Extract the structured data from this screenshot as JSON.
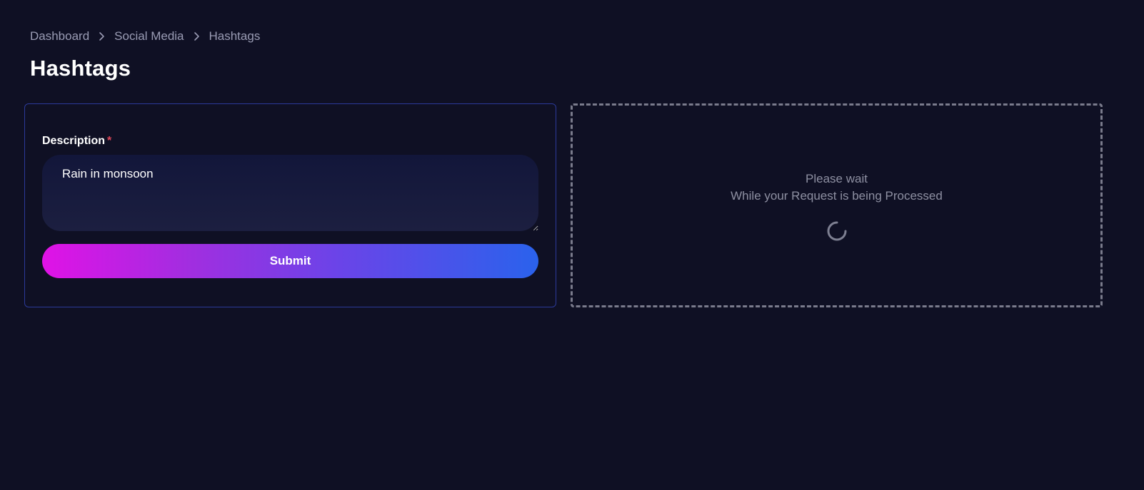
{
  "breadcrumb": {
    "items": [
      {
        "label": "Dashboard"
      },
      {
        "label": "Social Media"
      },
      {
        "label": "Hashtags"
      }
    ],
    "separator_icon": "chevron-right-icon"
  },
  "page": {
    "title": "Hashtags"
  },
  "form": {
    "description_label": "Description",
    "required_mark": "*",
    "description_value": "Rain in monsoon",
    "submit_label": "Submit"
  },
  "status": {
    "line1": "Please wait",
    "line2": "While your Request is being Processed",
    "spinner_icon": "loading-spinner-icon"
  },
  "colors": {
    "background": "#0f1024",
    "required": "#e0485a",
    "submit_gradient_start": "#e012e6",
    "submit_gradient_end": "#2a62ec",
    "card_border": "#2c3a9a"
  }
}
